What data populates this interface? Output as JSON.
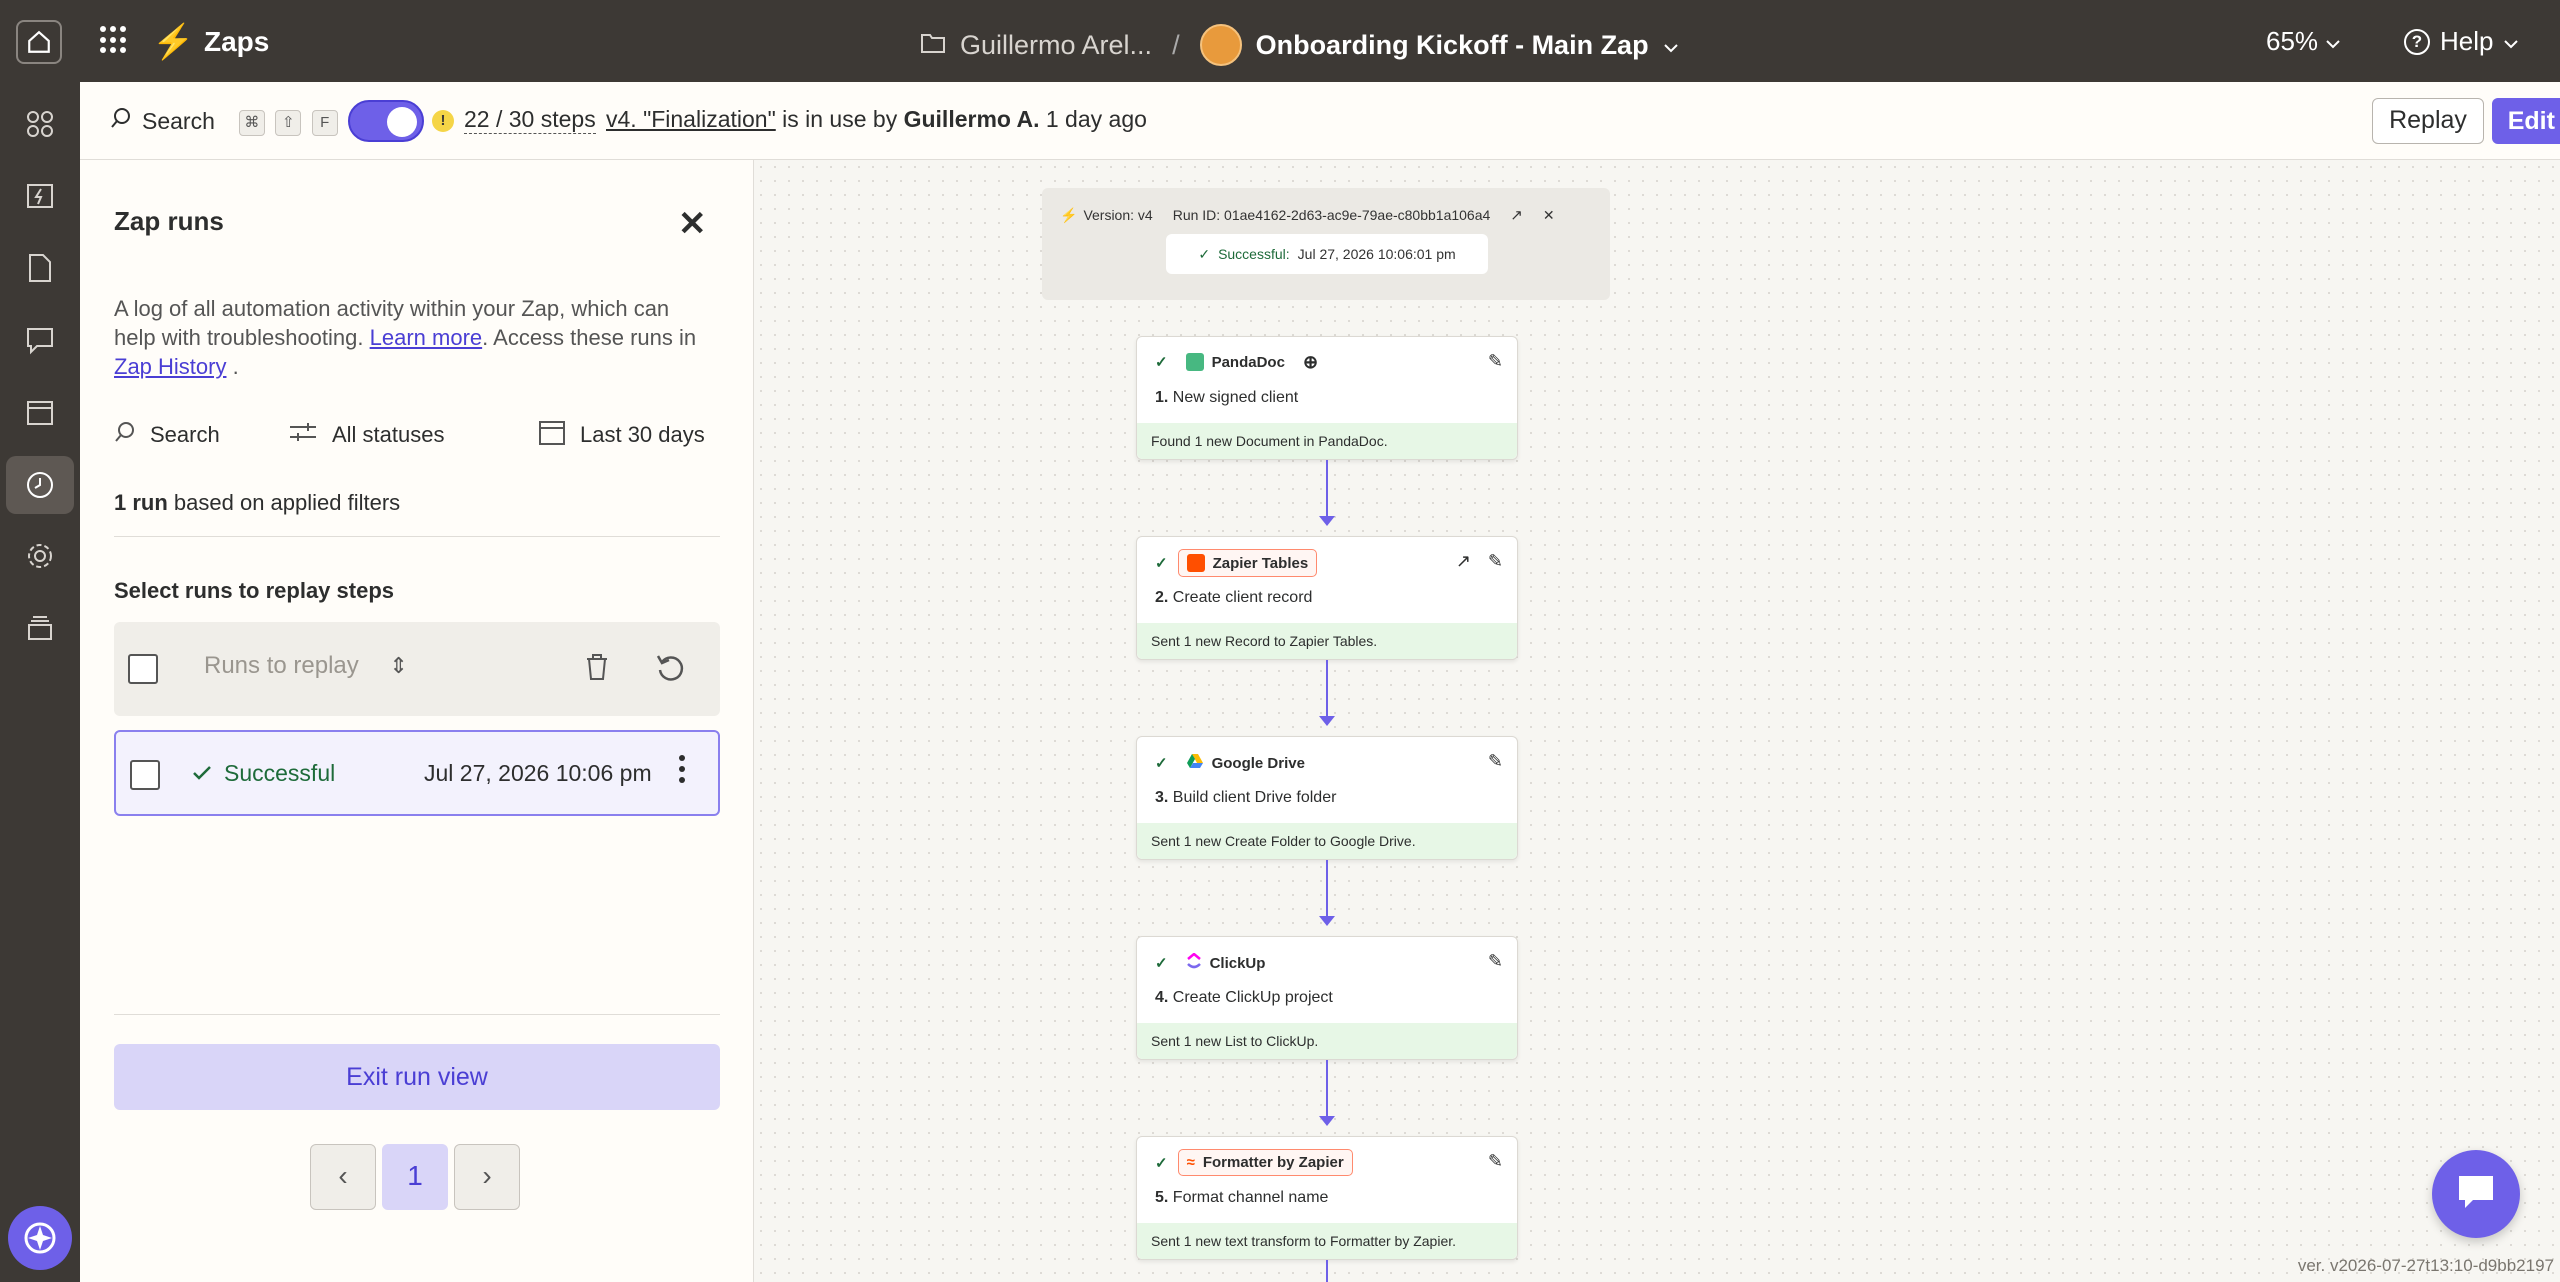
{
  "topbar": {
    "app_title": "Zaps",
    "folder": "Guillermo Arel...",
    "separator": "/",
    "zap_name": "Onboarding Kickoff - Main Zap",
    "zoom": "65%",
    "help": "Help"
  },
  "toolbar": {
    "search_label": "Search",
    "shortcut_keys": [
      "⌘",
      "⇧",
      "F"
    ],
    "steps_count": "22 / 30 steps",
    "version_link": "v4. \"Finalization\"",
    "in_use_text": "is in use by",
    "user": "Guillermo A.",
    "time_ago": "1 day ago",
    "replay_label": "Replay",
    "edit_label": "Edit Zap"
  },
  "panel": {
    "title": "Zap runs",
    "desc_part1": "A log of all automation activity within your Zap, which can help with troubleshooting.",
    "learn_more": "Learn more",
    "desc_part2": ". Access these runs in",
    "zap_history": "Zap History",
    "desc_part3": ".",
    "filter_search": "Search",
    "filter_status": "All statuses",
    "filter_date": "Last 30 days",
    "runs_count_bold": "1 run",
    "runs_count_text": "based on applied filters",
    "select_title": "Select runs to replay steps",
    "runs_to_replay": "Runs to replay",
    "run": {
      "status": "Successful",
      "date": "Jul 27, 2026 10:06 pm"
    },
    "exit_label": "Exit run view",
    "page": "1"
  },
  "canvas": {
    "run_info": {
      "version": "Version: v4",
      "run_id": "Run ID:  01ae4162-2d63-ac9e-79ae-c80bb1a106a4",
      "status": "Successful:",
      "timestamp": "Jul 27, 2026 10:06:01 pm"
    },
    "steps": [
      {
        "app": "PandaDoc",
        "num": "1.",
        "title": "New signed client",
        "result": "Found 1 new Document in PandaDoc.",
        "icon_color": "#47b881"
      },
      {
        "app": "Zapier Tables",
        "num": "2.",
        "title": "Create client record",
        "result": "Sent 1 new Record to Zapier Tables.",
        "icon_color": "#ff4f00"
      },
      {
        "app": "Google Drive",
        "num": "3.",
        "title": "Build client Drive folder",
        "result": "Sent 1 new Create Folder to Google Drive.",
        "icon_color": "#fbbc04"
      },
      {
        "app": "ClickUp",
        "num": "4.",
        "title": "Create ClickUp project",
        "result": "Sent 1 new List to ClickUp.",
        "icon_color": "#7b68ee"
      },
      {
        "app": "Formatter by Zapier",
        "num": "5.",
        "title": "Format channel name",
        "result": "Sent 1 new text transform to Formatter by Zapier.",
        "icon_color": "#ff4f00"
      }
    ],
    "version_stamp": "ver. v2026-07-27t13:10-d9bb2197"
  },
  "colors": {
    "accent": "#6e60e8",
    "dark": "#3d3935",
    "success": "#1e6b3a",
    "brand": "#ff4f00"
  }
}
